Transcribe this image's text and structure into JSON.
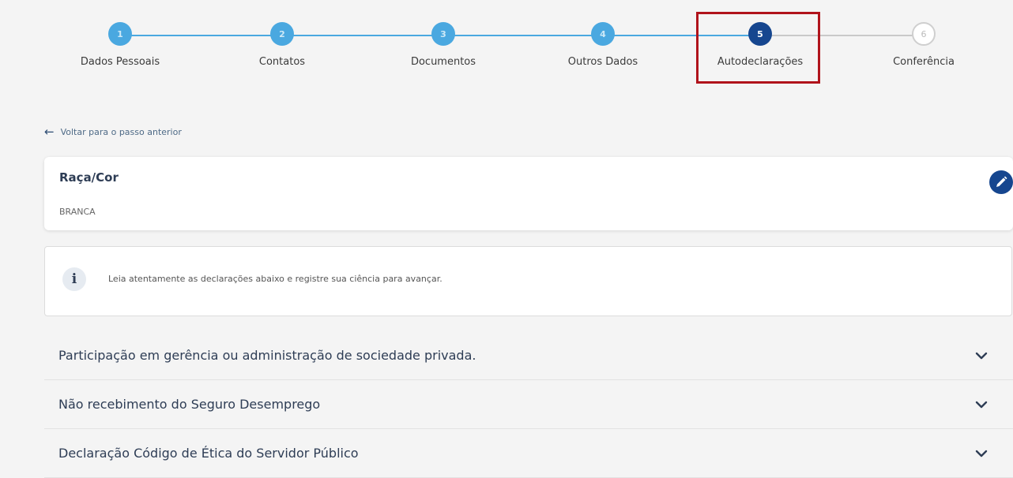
{
  "stepper": {
    "steps": [
      {
        "number": "1",
        "label": "Dados Pessoais",
        "state": "done"
      },
      {
        "number": "2",
        "label": "Contatos",
        "state": "done"
      },
      {
        "number": "3",
        "label": "Documentos",
        "state": "done"
      },
      {
        "number": "4",
        "label": "Outros Dados",
        "state": "done"
      },
      {
        "number": "5",
        "label": "Autodeclarações",
        "state": "active"
      },
      {
        "number": "6",
        "label": "Conferência",
        "state": "pending"
      }
    ],
    "colors": {
      "done": "#4aa8e0",
      "active": "#16468f",
      "pending": "#cfcfcf"
    }
  },
  "back_link": {
    "label": "Voltar para o passo anterior",
    "icon": "arrow-left-icon"
  },
  "race_card": {
    "title": "Raça/Cor",
    "value": "BRANCA",
    "edit_icon": "pencil-icon"
  },
  "info": {
    "icon": "info-icon",
    "text": "Leia atentamente as declarações abaixo e registre sua ciência para avançar."
  },
  "declarations": [
    {
      "title": "Participação em gerência ou administração de sociedade privada."
    },
    {
      "title": "Não recebimento do Seguro Desemprego"
    },
    {
      "title": "Declaração Código de Ética do Servidor Público"
    }
  ]
}
